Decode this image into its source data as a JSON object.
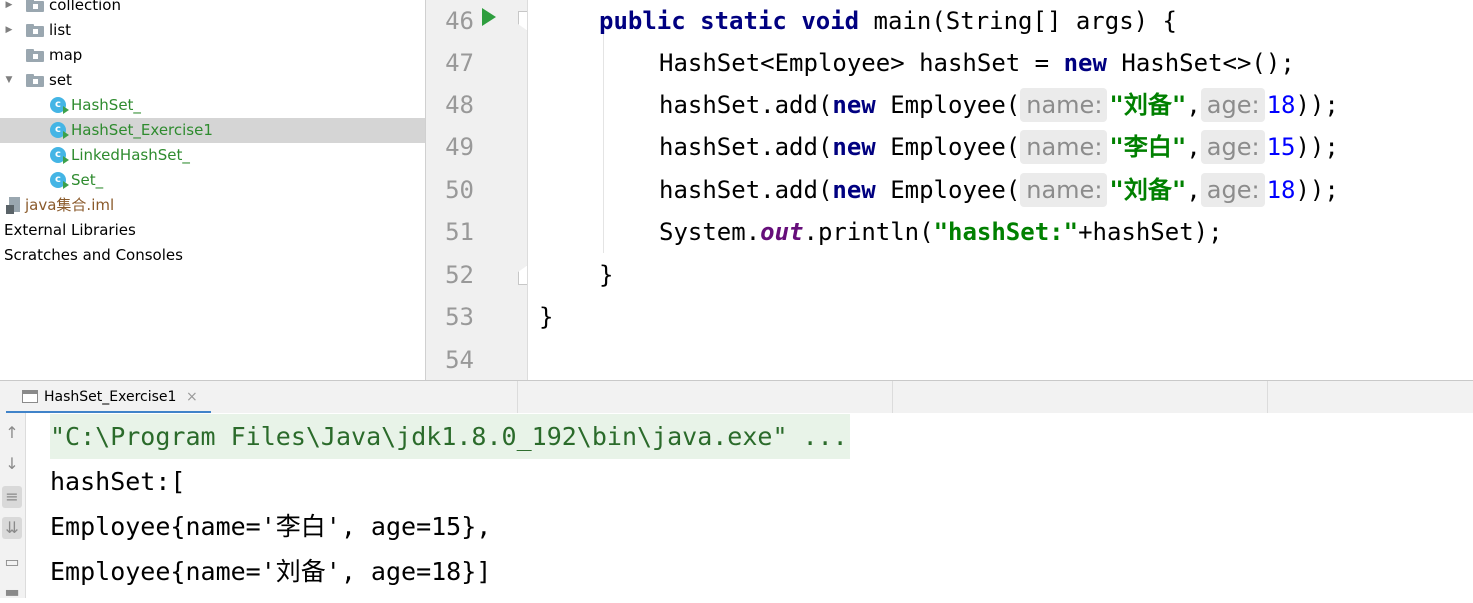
{
  "project_tree": {
    "items": [
      {
        "label": "collection",
        "kind": "folder",
        "expanded": false
      },
      {
        "label": "list",
        "kind": "folder",
        "expanded": false
      },
      {
        "label": "map",
        "kind": "folder"
      },
      {
        "label": "set",
        "kind": "folder",
        "expanded": true
      },
      {
        "label": "HashSet_",
        "kind": "class"
      },
      {
        "label": "HashSet_Exercise1",
        "kind": "class",
        "selected": true
      },
      {
        "label": "LinkedHashSet_",
        "kind": "class"
      },
      {
        "label": "Set_",
        "kind": "class"
      },
      {
        "label": "java集合.iml",
        "kind": "iml"
      },
      {
        "label": "External Libraries",
        "kind": "root"
      },
      {
        "label": "Scratches and Consoles",
        "kind": "root"
      }
    ]
  },
  "editor": {
    "line_numbers": [
      "46",
      "47",
      "48",
      "49",
      "50",
      "51",
      "52",
      "53",
      "54"
    ],
    "lines": {
      "l46": {
        "kw1": "public",
        "kw2": "static",
        "kw3": "void",
        "rest": " main(String[] args) {"
      },
      "l47": {
        "pre": "HashSet<Employee> hashSet = ",
        "kw": "new",
        "post": " HashSet<>();"
      },
      "l48": {
        "pre": "hashSet.add(",
        "kw": "new",
        "mid": " Employee(",
        "hint_name": "name:",
        "str": "\"刘备\"",
        "comma": ",",
        "hint_age": "age:",
        "num": "18",
        "end": "));"
      },
      "l49": {
        "pre": "hashSet.add(",
        "kw": "new",
        "mid": " Employee(",
        "hint_name": "name:",
        "str": "\"李白\"",
        "comma": ",",
        "hint_age": "age:",
        "num": "15",
        "end": "));"
      },
      "l50": {
        "pre": "hashSet.add(",
        "kw": "new",
        "mid": " Employee(",
        "hint_name": "name:",
        "str": "\"刘备\"",
        "comma": ",",
        "hint_age": "age:",
        "num": "18",
        "end": "));"
      },
      "l51": {
        "pre": "System.",
        "field": "out",
        "mid": ".println(",
        "str": "\"hashSet:\"",
        "end": "+hashSet);"
      },
      "l52": {
        "text": "}"
      },
      "l53": {
        "text": "}"
      }
    }
  },
  "run_panel": {
    "tab_label": "HashSet_Exercise1",
    "close_glyph": "×",
    "console_lines": [
      "\"C:\\Program Files\\Java\\jdk1.8.0_192\\bin\\java.exe\" ...",
      "hashSet:[",
      "Employee{name='李白', age=15},",
      "Employee{name='刘备', age=18}]"
    ]
  },
  "icons": {
    "toolbar": [
      "up-arrow-icon",
      "down-arrow-icon",
      "soft-wrap-icon",
      "scroll-to-end-icon",
      "print-icon",
      "trash-icon"
    ]
  },
  "colors": {
    "keyword": "#000080",
    "string": "#008000",
    "number": "#0000ff",
    "static_field": "#660e7a",
    "selection": "#d5d5d5",
    "tab_underline": "#4083c9",
    "console_command_bg": "#e8f3e8"
  }
}
